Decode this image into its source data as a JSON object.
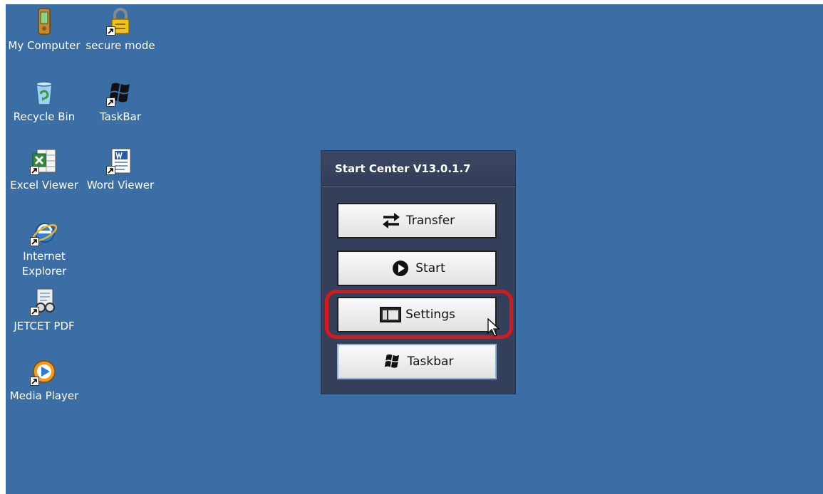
{
  "desktop": {
    "background": "#3a6ea5",
    "icons": [
      {
        "label": "My Computer",
        "icon": "pda-device-icon",
        "shortcut": false
      },
      {
        "label": "secure mode",
        "icon": "padlock-icon",
        "shortcut": true
      },
      {
        "label": "Recycle Bin",
        "icon": "recycle-bin-icon",
        "shortcut": false
      },
      {
        "label": "TaskBar",
        "icon": "windows-flag-icon",
        "shortcut": true
      },
      {
        "label": "Excel Viewer",
        "icon": "excel-icon",
        "shortcut": true
      },
      {
        "label": "Word Viewer",
        "icon": "word-icon",
        "shortcut": true
      },
      {
        "label": "Internet Explorer",
        "icon": "internet-explorer-icon",
        "shortcut": true
      },
      {
        "label": "JETCET PDF",
        "icon": "pdf-viewer-icon",
        "shortcut": true
      },
      {
        "label": "Media Player",
        "icon": "media-player-icon",
        "shortcut": true
      }
    ]
  },
  "start_center": {
    "title": "Start Center V13.0.1.7",
    "buttons": [
      {
        "label": "Transfer",
        "icon": "transfer-arrows-icon"
      },
      {
        "label": "Start",
        "icon": "play-circle-icon"
      },
      {
        "label": "Settings",
        "icon": "settings-window-icon"
      },
      {
        "label": "Taskbar",
        "icon": "windows-flag-icon"
      }
    ],
    "highlighted_button": "Settings",
    "highlight_color": "#d9161c"
  }
}
